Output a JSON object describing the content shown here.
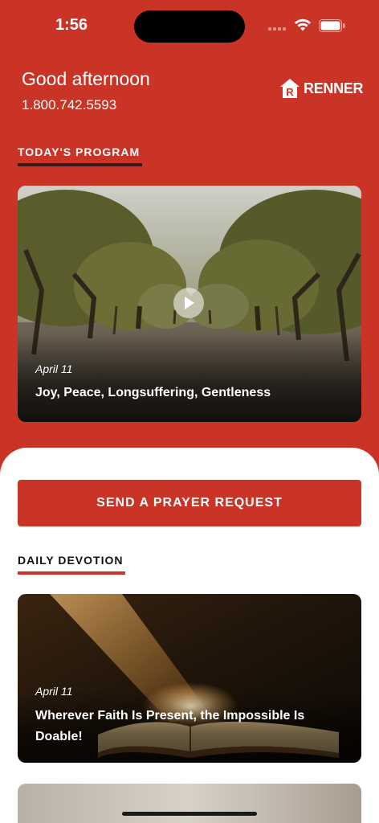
{
  "status_bar": {
    "time": "1:56"
  },
  "header": {
    "greeting": "Good afternoon",
    "phone": "1.800.742.5593",
    "logo_text": "RENNER"
  },
  "program": {
    "section_title": "TODAY'S PROGRAM",
    "date": "April 11",
    "title": "Joy, Peace, Longsuffering, Gentleness"
  },
  "prayer_button": {
    "label": "SEND A PRAYER REQUEST"
  },
  "devotion": {
    "section_title": "DAILY DEVOTION",
    "date": "April 11",
    "title": "Wherever Faith Is Present, the Impossible Is Doable!"
  },
  "colors": {
    "brand_red": "#c93427",
    "white": "#ffffff"
  },
  "icons": [
    "wifi-icon",
    "battery-icon",
    "play-icon",
    "renner-logo-icon"
  ]
}
